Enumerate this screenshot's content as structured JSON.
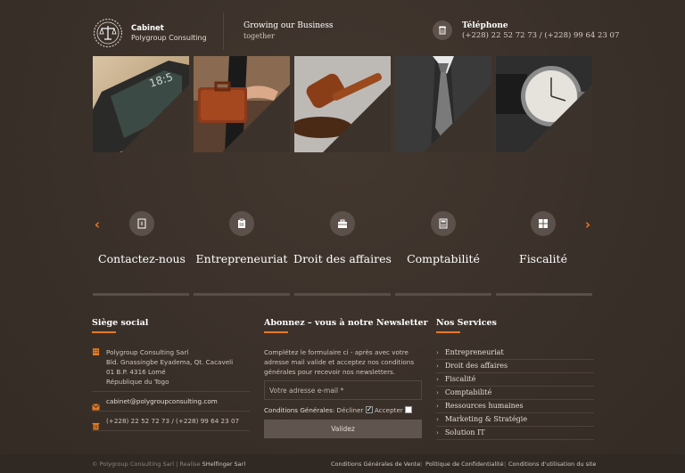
{
  "header": {
    "logo_name": "Cabinet",
    "logo_sub": "Polygroup Consulting",
    "tagline_1": "Growing our Business",
    "tagline_2": "together",
    "phone_title": "Téléphone",
    "phone_numbers": "(+228) 22 52 72 73 / (+228) 99 64 23 07"
  },
  "tiles": [
    "phone-image",
    "briefcase-image",
    "gavel-image",
    "tie-image",
    "watch-image"
  ],
  "services": [
    {
      "label": "Contactez-nous",
      "icon": "contact-book-icon"
    },
    {
      "label": "Entrepreneuriat",
      "icon": "clipboard-icon"
    },
    {
      "label": "Droit des affaires",
      "icon": "briefcase-icon"
    },
    {
      "label": "Comptabilité",
      "icon": "calculator-icon"
    },
    {
      "label": "Fiscalité",
      "icon": "grid-icon"
    }
  ],
  "siege": {
    "title": "Siège social",
    "company": "Polygroup Consulting Sarl",
    "street": "Bld. Gnassingbe Eyadema, Qt. Cacaveli",
    "po": "01 B.P. 4316 Lomé",
    "country": "République du Togo",
    "email": "cabinet@polygroupconsulting.com",
    "phones": "(+228) 22 52 72 73 / (+228) 99 64 23 07"
  },
  "newsletter": {
    "title": "Abonnez – vous à notre Newsletter",
    "desc_1": "Complétez le formulaire ci - après avec votre",
    "desc_2": "adresse mail valide et acceptez nos conditions",
    "desc_3": "générales pour recevoir nos newsletters.",
    "email_placeholder": "Votre adresse e-mail *",
    "conditions_label": "Conditions Générales:",
    "decline_label": "Décliner",
    "accept_label": "Accepter",
    "submit_label": "Validez"
  },
  "services_list": {
    "title": "Nos Services",
    "items": [
      "Entrepreneuriat",
      "Droit des affaires",
      "Fiscalité",
      "Comptabilité",
      "Ressources humaines",
      "Marketing & Stratégie",
      "Solution IT"
    ]
  },
  "footer": {
    "copyright": "© Polygroup Consulting Sarl",
    "realise_prefix": "| Realise",
    "realise_by": "SHelfinger Sarl",
    "links": [
      "Conditions Générales de Vente",
      "Politique de Confidentialité",
      "Conditions d'utilisation du site"
    ]
  },
  "colors": {
    "accent": "#e8791e",
    "background": "#3b322c"
  }
}
